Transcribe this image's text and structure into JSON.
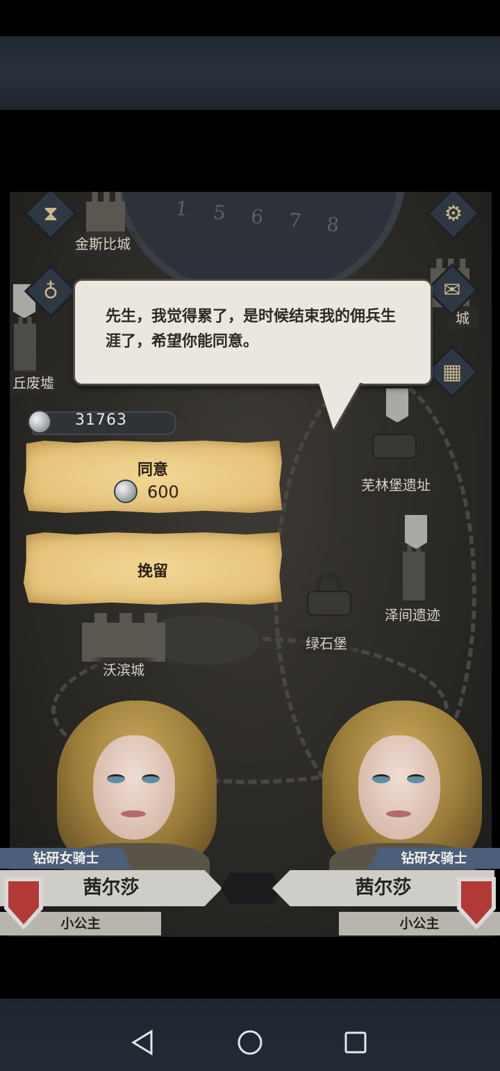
{
  "dialog": {
    "speech": "先生，我觉得累了，是时候结束我的佣兵生涯了，希望你能同意。"
  },
  "currency": {
    "silver": "31763"
  },
  "actions": {
    "agree_label": "同意",
    "agree_cost": "600",
    "stay_label": "挽留"
  },
  "map": {
    "places": [
      "金斯比城",
      "丘废墟",
      "芜林堡遗址",
      "泽间遗迹",
      "绿石堡",
      "沃滨城"
    ],
    "partial_places": [
      "城"
    ],
    "dial_numbers": "1 5 6 7 8"
  },
  "characters": [
    {
      "class": "钻研女骑士",
      "name": "茜尔莎",
      "title": "小公主"
    },
    {
      "class": "钻研女骑士",
      "name": "茜尔莎",
      "title": "小公主"
    }
  ],
  "colors": {
    "parchment": "#e8c880",
    "bubble": "#ebe6de",
    "class_tag": "#4b5e7a",
    "shield_red": "#b23a36"
  },
  "icons": [
    "hourglass-icon",
    "moneybag-icon",
    "gear-icon",
    "mail-icon",
    "book-icon",
    "silver-coin-icon",
    "lock-icon",
    "shield-icon",
    "back-icon",
    "home-icon",
    "recent-icon"
  ]
}
